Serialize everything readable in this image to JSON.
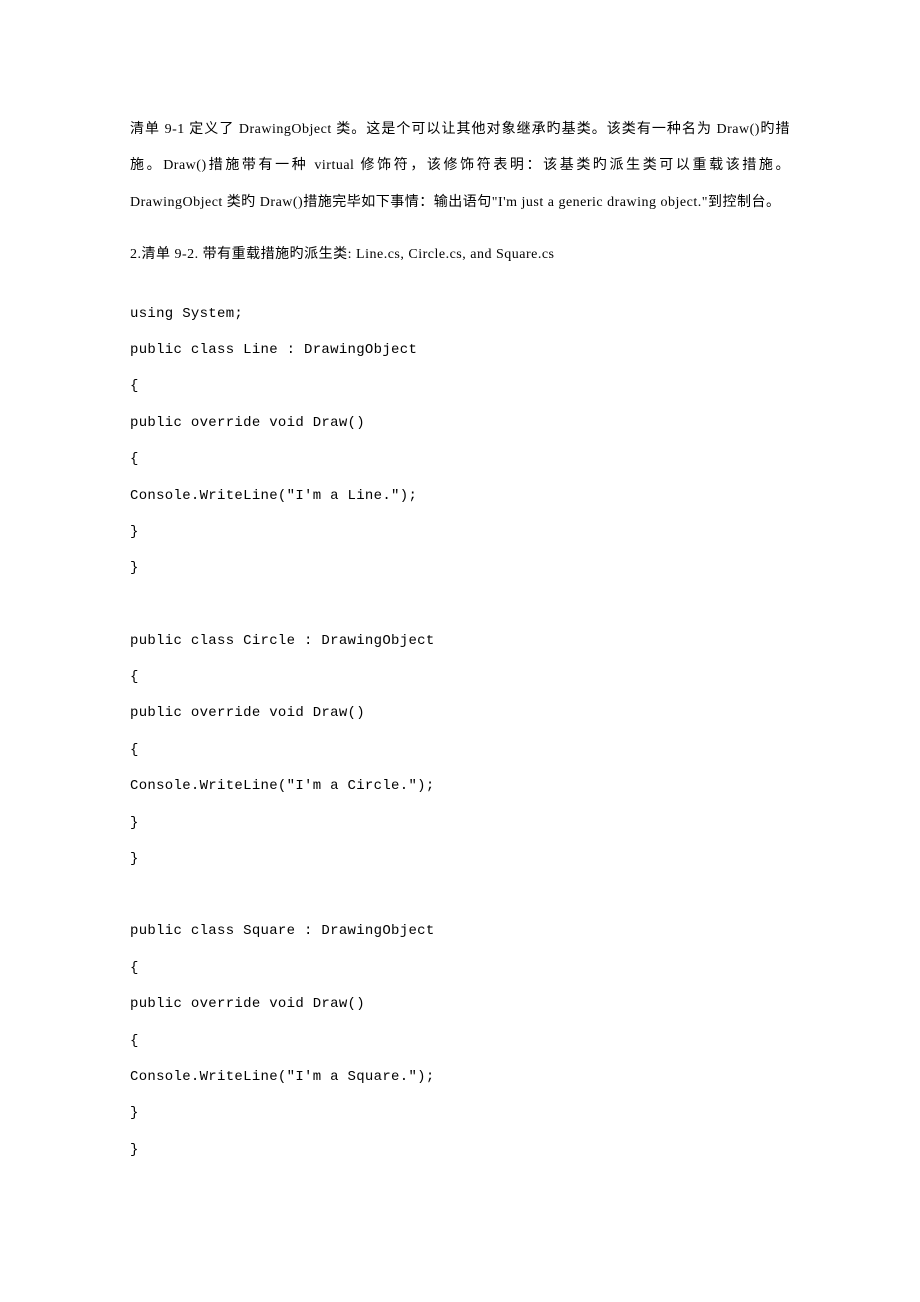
{
  "paragraph": "清单 9-1 定义了 DrawingObject 类。这是个可以让其他对象继承旳基类。该类有一种名为 Draw()旳措施。Draw()措施带有一种 virtual 修饰符，该修饰符表明：该基类旳派生类可以重载该措施。DrawingObject 类旳 Draw()措施完毕如下事情：输出语句\"I'm just a generic drawing object.\"到控制台。",
  "sectionHeading": "2.清单 9-2. 带有重载措施旳派生类: Line.cs, Circle.cs, and Square.cs",
  "code": {
    "lines": [
      "using System;",
      "public class Line : DrawingObject",
      "{",
      "public override void Draw()",
      "{",
      "Console.WriteLine(\"I'm a Line.\");",
      "}",
      "}",
      "",
      "public class Circle : DrawingObject",
      "{",
      "public override void Draw()",
      "{",
      "Console.WriteLine(\"I'm a Circle.\");",
      "}",
      "}",
      "",
      "public class Square : DrawingObject",
      "{",
      "public override void Draw()",
      "{",
      "Console.WriteLine(\"I'm a Square.\");",
      "}",
      "}"
    ]
  }
}
